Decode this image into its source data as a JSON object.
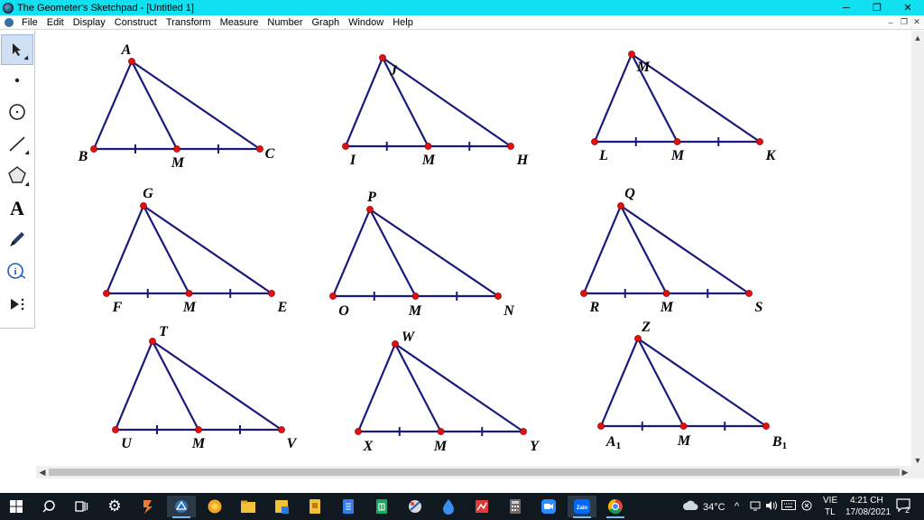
{
  "window": {
    "title": "The Geometer's Sketchpad - [Untitled 1]",
    "minimize_glyph": "─",
    "restore_glyph": "❐",
    "close_glyph": "✕"
  },
  "menu": {
    "items": [
      "File",
      "Edit",
      "Display",
      "Construct",
      "Transform",
      "Measure",
      "Number",
      "Graph",
      "Window",
      "Help"
    ],
    "mdi_minimize": "–",
    "mdi_restore": "❐",
    "mdi_close": "✕"
  },
  "toolbox": {
    "tools": [
      {
        "name": "arrow-tool-icon",
        "glyph": "➤"
      },
      {
        "name": "point-tool-icon",
        "glyph": "•"
      },
      {
        "name": "compass-tool-icon",
        "glyph": "⊙"
      },
      {
        "name": "straightedge-tool-icon",
        "glyph": "／"
      },
      {
        "name": "polygon-tool-icon",
        "glyph": "⬠"
      },
      {
        "name": "text-tool-icon",
        "glyph": "A"
      },
      {
        "name": "marker-tool-icon",
        "glyph": "✎"
      },
      {
        "name": "information-tool-icon",
        "glyph": "ⓘ"
      },
      {
        "name": "custom-tool-icon",
        "glyph": "▶⋮"
      }
    ]
  },
  "sketch": {
    "line_color": "#1a1a7a",
    "point_color": "#e01010",
    "triangles": [
      {
        "apex": "A",
        "left": "B",
        "mid": "M",
        "right": "C"
      },
      {
        "apex": "J",
        "left": "I",
        "mid": "M",
        "right": "H"
      },
      {
        "apex": "M",
        "left": "L",
        "mid": "M",
        "right": "K"
      },
      {
        "apex": "G",
        "left": "F",
        "mid": "M",
        "right": "E"
      },
      {
        "apex": "P",
        "left": "O",
        "mid": "M",
        "right": "N"
      },
      {
        "apex": "Q",
        "left": "R",
        "mid": "M",
        "right": "S"
      },
      {
        "apex": "T",
        "left": "U",
        "mid": "M",
        "right": "V"
      },
      {
        "apex": "W",
        "left": "X",
        "mid": "M",
        "right": "Y"
      },
      {
        "apex": "Z",
        "left": "A",
        "left_sub": "1",
        "mid": "M",
        "right": "B",
        "right_sub": "1"
      }
    ]
  },
  "taskbar": {
    "items": [
      {
        "name": "start-icon",
        "glyph": "⊞"
      },
      {
        "name": "search-icon",
        "glyph": "⚲"
      },
      {
        "name": "task-view-icon",
        "glyph": "▤"
      },
      {
        "name": "settings-icon",
        "glyph": "⚙"
      },
      {
        "name": "app-icon-1",
        "glyph": "◆"
      },
      {
        "name": "sketchpad-taskbar-icon",
        "glyph": "◉"
      },
      {
        "name": "browser-icon",
        "glyph": "●"
      },
      {
        "name": "file-explorer-icon",
        "glyph": "▬"
      },
      {
        "name": "app-icon-2",
        "glyph": "▰"
      },
      {
        "name": "app-icon-3",
        "glyph": "▣"
      },
      {
        "name": "word-icon",
        "glyph": "▤"
      },
      {
        "name": "sheets-icon",
        "glyph": "▦"
      },
      {
        "name": "app-icon-4",
        "glyph": "✿"
      },
      {
        "name": "app-icon-5",
        "glyph": "◈"
      },
      {
        "name": "app-icon-6",
        "glyph": "▨"
      },
      {
        "name": "calculator-icon",
        "glyph": "▦"
      },
      {
        "name": "zoom-icon",
        "glyph": "■"
      },
      {
        "name": "zalo-icon",
        "glyph": "Zalo"
      },
      {
        "name": "chrome-icon",
        "glyph": "◎"
      }
    ],
    "weather": "34°C",
    "tray_chevron": "^",
    "language_top": "VIE",
    "language_bottom": "TL",
    "time": "4:21 CH",
    "date": "17/08/2021",
    "notification_count": "2"
  },
  "colors": {
    "titlebar": "#10e0f0",
    "taskbar": "#101820"
  }
}
